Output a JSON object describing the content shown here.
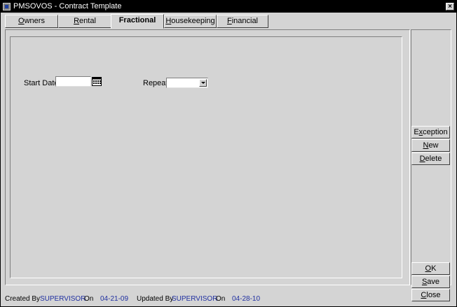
{
  "window": {
    "title": "PMSOVOS - Contract Template",
    "close_symbol": "×"
  },
  "tabs": [
    {
      "pre": "",
      "key": "O",
      "post": "wners"
    },
    {
      "pre": "",
      "key": "R",
      "post": "ental"
    },
    {
      "pre": "",
      "key": "",
      "post": "Fractional"
    },
    {
      "pre": "",
      "key": "H",
      "post": "ousekeeping"
    },
    {
      "pre": "",
      "key": "F",
      "post": "inancial"
    }
  ],
  "form": {
    "start_date_label": "Start Date",
    "start_date_value": "",
    "repeat_label": "Repeat",
    "repeat_value": ""
  },
  "side_buttons": {
    "exception": {
      "pre": "E",
      "key": "x",
      "post": "ception"
    },
    "new": {
      "pre": "",
      "key": "N",
      "post": "ew"
    },
    "delete": {
      "pre": "",
      "key": "D",
      "post": "elete"
    },
    "ok": {
      "pre": "",
      "key": "O",
      "post": "K"
    },
    "save": {
      "pre": "",
      "key": "S",
      "post": "ave"
    },
    "close": {
      "pre": "",
      "key": "C",
      "post": "lose"
    }
  },
  "status": {
    "created_by_label": "Created By",
    "created_by_value": "SUPERVISOR",
    "created_on_label": "On",
    "created_on_value": "04-21-09",
    "updated_by_label": "Updated By",
    "updated_by_value": "SUPERVISOR",
    "updated_on_label": "On",
    "updated_on_value": "04-28-10"
  },
  "icons": {
    "app": "application-icon",
    "calendar": "calendar-icon",
    "dropdown": "chevron-down-icon"
  }
}
